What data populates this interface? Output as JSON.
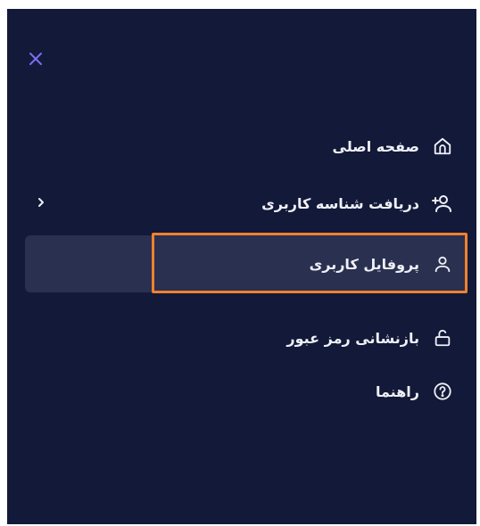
{
  "menu": {
    "close_icon": "close-icon",
    "items": [
      {
        "label": "صفحه اصلی",
        "icon": "home-icon"
      },
      {
        "label": "دریافت شناسه کاربری",
        "icon": "add-user-icon",
        "has_submenu": true
      },
      {
        "label": "پروفایل کاربری",
        "icon": "user-icon",
        "active": true
      },
      {
        "label": "بازنشانی رمز عبور",
        "icon": "unlock-icon"
      },
      {
        "label": "راهنما",
        "icon": "help-icon"
      }
    ]
  },
  "colors": {
    "background": "#131938",
    "active_bg": "#2a3050",
    "highlight": "#f0812e",
    "text": "#eef0f7",
    "close_icon": "#7b6cf0"
  }
}
